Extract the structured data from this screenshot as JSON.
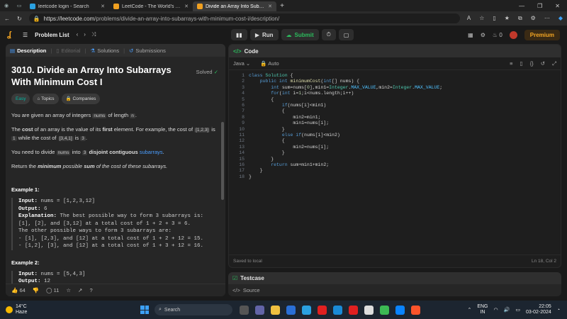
{
  "browser": {
    "tabs": [
      {
        "label": "leetcode login - Search",
        "active": false
      },
      {
        "label": "LeetCode - The World's Leading",
        "active": false
      },
      {
        "label": "Divide an Array Into Subarrays W",
        "active": true
      }
    ],
    "url_host": "https://leetcode.com",
    "url_path": "/problems/divide-an-array-into-subarrays-with-minimum-cost-i/description/"
  },
  "lcnav": {
    "problem_list": "Problem List",
    "run": "Run",
    "submit": "Submit",
    "streak_count": "0",
    "premium": "Premium"
  },
  "left": {
    "tabs": [
      "Description",
      "Editorial",
      "Solutions",
      "Submissions"
    ],
    "title": "3010. Divide an Array Into Subarrays With Minimum Cost I",
    "solved": "Solved",
    "chips": [
      "Easy",
      "Topics",
      "Companies"
    ],
    "p1_a": "You are given an array of integers",
    "p1_code": "nums",
    "p1_b": "of length",
    "p1_code2": "n",
    "p2_a": "The",
    "p2_bold": "cost",
    "p2_b": "of an array is the value of its",
    "p2_bold2": "first",
    "p2_c": "element. For example, the cost of",
    "p2_code": "[1,2,3]",
    "p2_d": "is",
    "p2_code2": "1",
    "p2_e": "while the cost of",
    "p2_code3": "[3,4,1]",
    "p2_f": "is",
    "p2_code4": "3",
    "p3_a": "You need to divide",
    "p3_code": "nums",
    "p3_b": "into",
    "p3_code2": "3",
    "p3_bold": "disjoint contiguous",
    "p3_link": "subarrays",
    "p4_a": "Return the",
    "p4_bold": "minimum",
    "p4_b": "possible",
    "p4_bold2": "sum",
    "p4_c": "of the cost of these subarrays.",
    "ex1_title": "Example 1:",
    "ex1_input_label": "Input:",
    "ex1_input": " nums = [1,2,3,12]",
    "ex1_output_label": "Output:",
    "ex1_output": " 6",
    "ex1_expl_label": "Explanation:",
    "ex1_expl": " The best possible way to form 3 subarrays is:\n[1], [2], and [3,12] at a total cost of 1 + 2 + 3 = 6.\nThe other possible ways to form 3 subarrays are:\n- [1], [2,3], and [12] at a total cost of 1 + 2 + 12 = 15.\n- [1,2], [3], and [12] at a total cost of 1 + 3 + 12 = 16.",
    "ex2_title": "Example 2:",
    "ex2_input_label": "Input:",
    "ex2_input": " nums = [5,4,3]",
    "ex2_output_label": "Output:",
    "ex2_output": " 12",
    "likes": "64",
    "comments": "11"
  },
  "code": {
    "tab": "Code",
    "language": "Java",
    "mode": "Auto",
    "saved": "Saved to local",
    "cursor": "Ln 18, Col 2"
  },
  "testcase": {
    "title": "Testcase",
    "source": "Source"
  },
  "taskbar": {
    "temp": "14°C",
    "weather": "Haze",
    "search": "Search",
    "lang1": "ENG",
    "lang2": "IN",
    "time": "22:05",
    "date": "03-02-2024"
  },
  "colors": {
    "accent_green": "#2cbb5d",
    "easy": "#00b8a3",
    "premium": "#f5a623"
  }
}
